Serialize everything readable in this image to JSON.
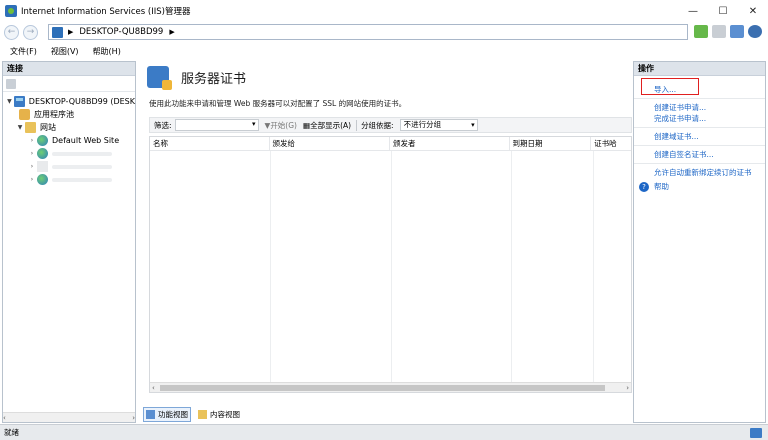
{
  "window": {
    "title": "Internet Information Services (IIS)管理器",
    "controls": {
      "minimize": "—",
      "maximize": "☐",
      "close": "✕"
    }
  },
  "address": {
    "back_icon": "back-arrow-icon",
    "forward_icon": "forward-arrow-icon",
    "crumbs": [
      "DESKTOP-QU8BD99"
    ]
  },
  "menu": [
    "文件(F)",
    "视图(V)",
    "帮助(H)"
  ],
  "connections": {
    "header": "连接",
    "tree": [
      {
        "label": "DESKTOP-QU8BD99 (DESK",
        "icon": "server-icon",
        "expanded": true
      },
      {
        "label": "应用程序池",
        "icon": "app-pool-icon"
      },
      {
        "label": "网站",
        "icon": "sites-folder-icon",
        "expanded": true
      },
      {
        "label": "Default Web Site",
        "icon": "globe-icon"
      }
    ]
  },
  "main": {
    "title": "服务器证书",
    "description": "使用此功能来申请和管理 Web 服务器可以对配置了 SSL 的网站使用的证书。",
    "filter": {
      "label": "筛选:",
      "go": "开始(G)",
      "show_all": "全部显示(A)",
      "group_label": "分组依据:",
      "group_value": "不进行分组"
    },
    "columns": [
      "名称",
      "颁发给",
      "颁发者",
      "到期日期",
      "证书哈"
    ],
    "views": {
      "features": "功能视图",
      "content": "内容视图"
    }
  },
  "actions": {
    "header": "操作",
    "items": [
      "导入...",
      "创建证书申请...",
      "完成证书申请...",
      "创建域证书...",
      "创建自签名证书...",
      "允许自动重新绑定续订的证书"
    ],
    "help": "帮助"
  },
  "status": {
    "text": "就绪"
  },
  "colors": {
    "link": "#1d66c6",
    "highlight_border": "#e02020",
    "pane_header": "#dde3ea"
  }
}
